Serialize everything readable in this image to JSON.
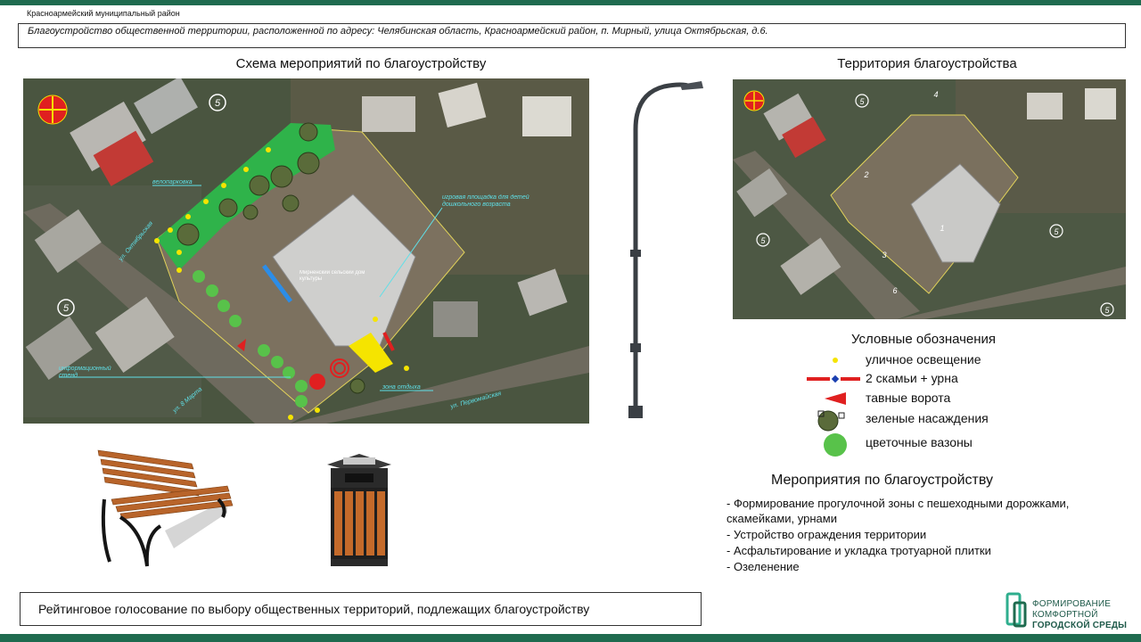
{
  "header": {
    "district": "Красноармейский  муниципальный район",
    "address": "Благоустройство общественной территории, расположенной по адресу: Челябинская область, Красноармейский район, п. Мирный, улица Октябрьская, д.6."
  },
  "scheme": {
    "title": "Схема мероприятий по благоустройству",
    "labels": {
      "bike_parking": "велопарковка",
      "playground": "игровая площадка для детей дошкольного возраста",
      "building": "Мирненский сельский дом культуры",
      "info_stand": "информационный стенд",
      "rest_zone": "зона отдыха",
      "street_oktyabrskaya": "ул. Октябрьская",
      "street_8marta": "ул. 8 Марта",
      "street_pervomayskaya": "ул. Первомайская",
      "house_number": "5"
    }
  },
  "territory": {
    "title": "Территория благоустройства",
    "markers": [
      "1",
      "2",
      "3",
      "4",
      "5",
      "6"
    ]
  },
  "legend": {
    "title": "Условные обозначения",
    "items": [
      {
        "icon": "yellow-dot",
        "label": "уличное освещение"
      },
      {
        "icon": "red-bench-line",
        "label": "2 скамьи + урна"
      },
      {
        "icon": "red-triangle",
        "label": "тавные ворота"
      },
      {
        "icon": "green-tree",
        "label": "зеленые насаждения"
      },
      {
        "icon": "green-circle",
        "label": "цветочные вазоны"
      }
    ]
  },
  "measures": {
    "title": "Мероприятия по благоустройству",
    "items": [
      "- Формирование прогулочной зоны с пешеходными дорожками, скамейками, урнами",
      "- Устройство ограждения территории",
      "- Асфальтирование и укладка тротуарной плитки",
      "- Озеленение"
    ]
  },
  "footer": {
    "vote": "Рейтинговое голосование по выбору общественных территорий, подлежащих  благоустройству",
    "brand_line1": "ФОРМИРОВАНИЕ",
    "brand_line2": "КОМФОРТНОЙ",
    "brand_line3": "ГОРОДСКОЙ СРЕДЫ"
  },
  "colors": {
    "bar": "#1f6b4f",
    "green_zone": "#2fb34a",
    "yellow": "#f5e400",
    "red": "#e02020",
    "flower": "#58c24a"
  }
}
